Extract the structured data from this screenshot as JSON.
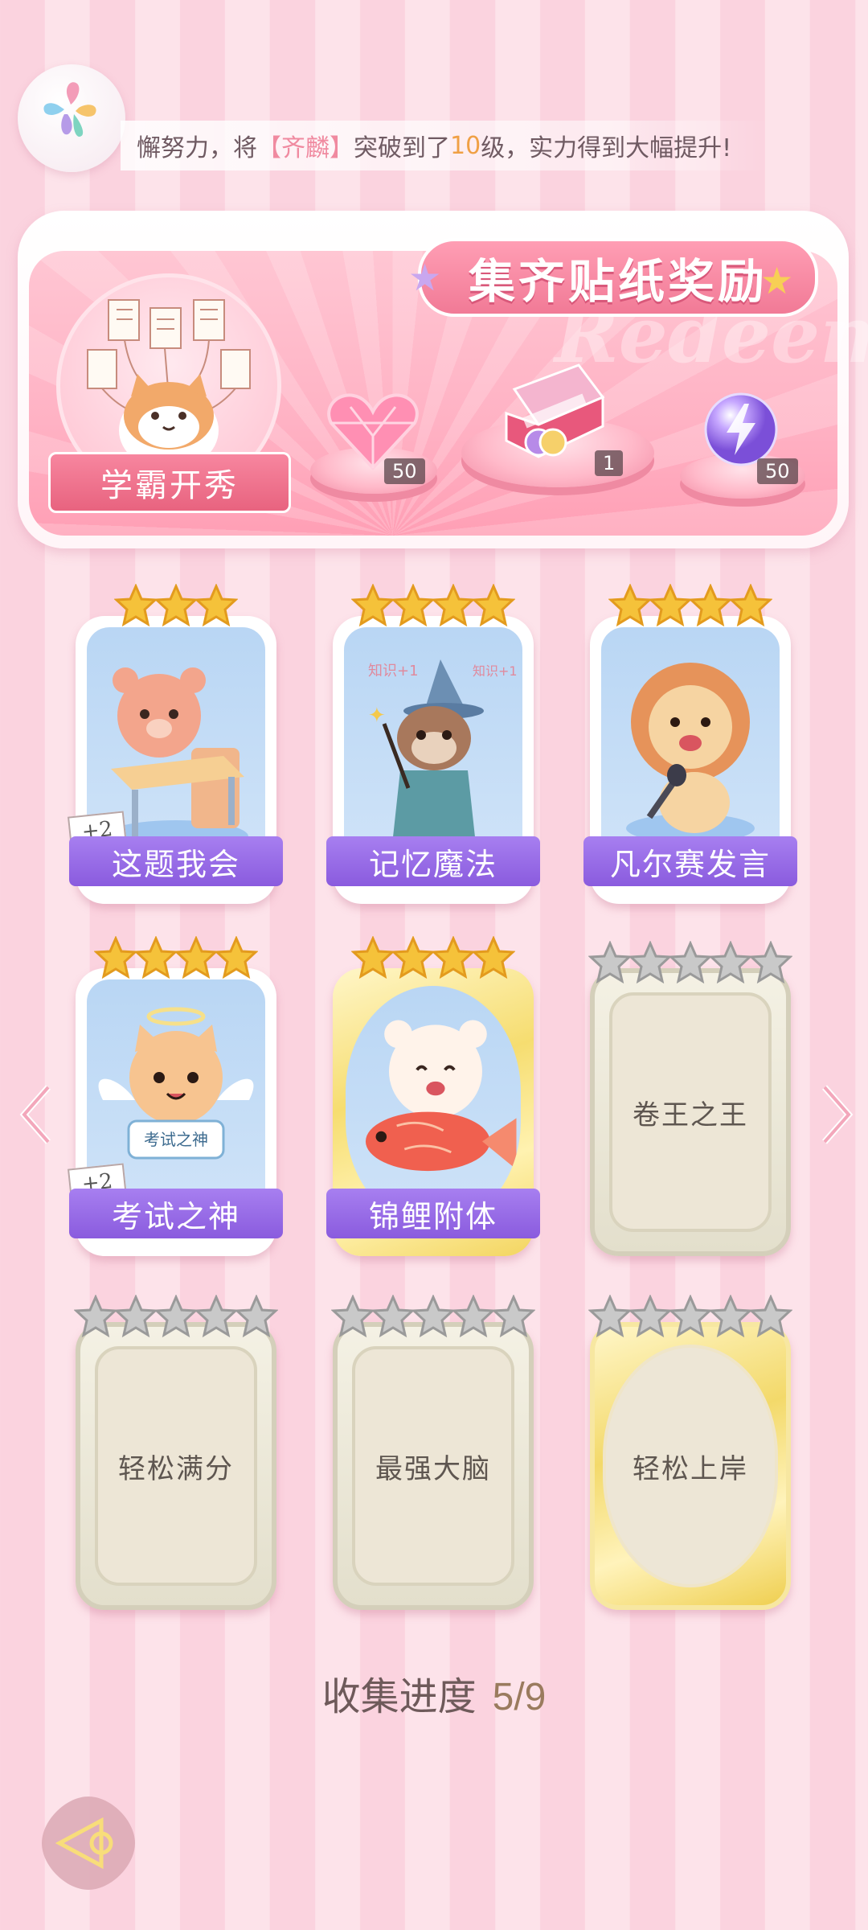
{
  "ticker": {
    "prefix": "懈努力，将",
    "name": "【齐麟】",
    "middle": "突破到了",
    "level": "10",
    "suffix": "级，实力得到大幅提升!"
  },
  "banner": {
    "title": "集齐贴纸奖励",
    "bg_word": "Redeem",
    "book_label": "学霸开秀",
    "rewards": [
      {
        "icon": "heart-gem-icon",
        "qty": "50"
      },
      {
        "icon": "gift-box-icon",
        "qty": "1"
      },
      {
        "icon": "lightning-orb-icon",
        "qty": "50"
      }
    ]
  },
  "stickers": [
    {
      "name": "这题我会",
      "stars": 3,
      "collected": true,
      "bonus": "+2",
      "icon": "bear-at-desk-icon"
    },
    {
      "name": "记忆魔法",
      "stars": 4,
      "collected": true,
      "bonus": "",
      "icon": "wizard-otter-icon",
      "art_text": [
        "知识+1",
        "知识+1"
      ]
    },
    {
      "name": "凡尔赛发言",
      "stars": 4,
      "collected": true,
      "bonus": "",
      "icon": "lion-microphone-icon"
    },
    {
      "name": "考试之神",
      "stars": 4,
      "collected": true,
      "bonus": "+2",
      "icon": "angel-cat-icon",
      "art_text": [
        "考试之神"
      ]
    },
    {
      "name": "锦鲤附体",
      "stars": 4,
      "collected": true,
      "bonus": "",
      "icon": "bear-koi-icon",
      "rarity": "gold"
    },
    {
      "name": "卷王之王",
      "stars": 5,
      "collected": false
    },
    {
      "name": "轻松满分",
      "stars": 5,
      "collected": false
    },
    {
      "name": "最强大脑",
      "stars": 5,
      "collected": false
    },
    {
      "name": "轻松上岸",
      "stars": 5,
      "collected": false,
      "rarity": "gold"
    }
  ],
  "progress": {
    "label": "收集进度",
    "value": "5/9"
  },
  "colors": {
    "label_purple": "#8a5bde",
    "pink_bg": "#fbd3df",
    "star_gold": "#f5c23a",
    "star_silver": "#c9c9c9"
  }
}
